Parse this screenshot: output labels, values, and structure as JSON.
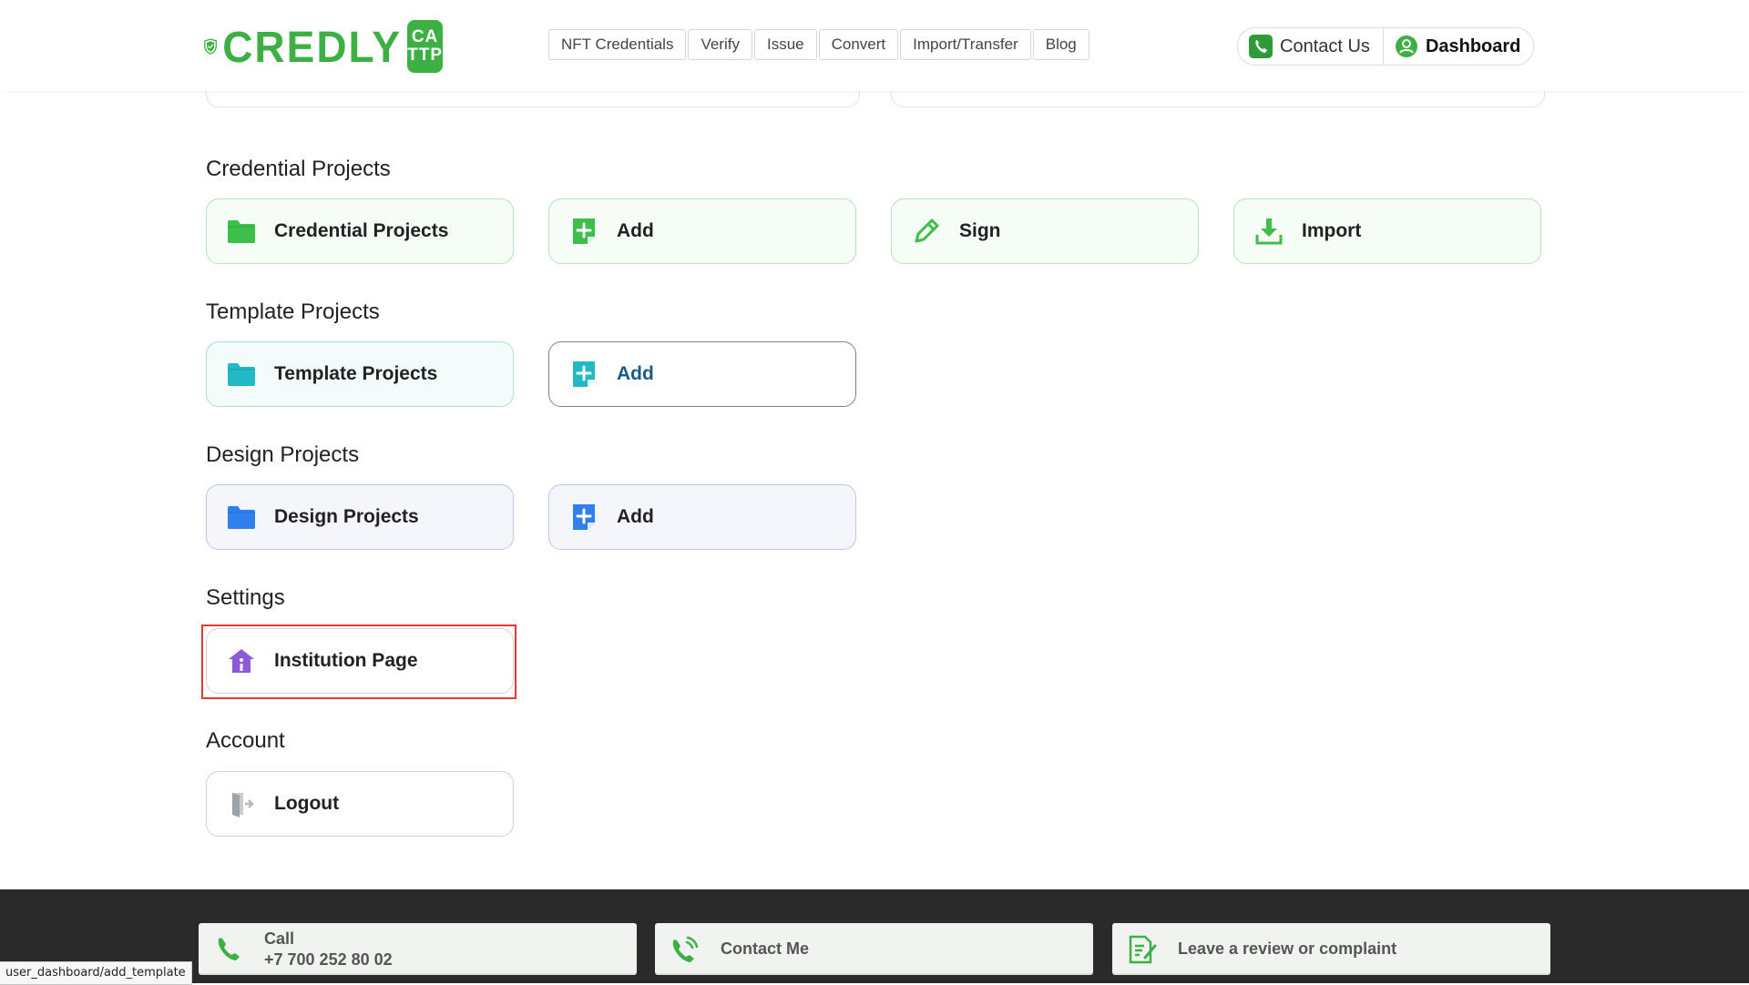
{
  "header": {
    "logo": {
      "word": "CREDLY",
      "badge_line1": "CA",
      "badge_line2": "TTP"
    },
    "nav": [
      "NFT Credentials",
      "Verify",
      "Issue",
      "Convert",
      "Import/Transfer",
      "Blog"
    ],
    "contact_label": "Contact Us",
    "dashboard_label": "Dashboard"
  },
  "sections": {
    "credential": {
      "title": "Credential Projects",
      "cards": [
        {
          "label": "Credential Projects",
          "icon": "folder-icon"
        },
        {
          "label": "Add",
          "icon": "add-file-icon"
        },
        {
          "label": "Sign",
          "icon": "pencil-icon"
        },
        {
          "label": "Import",
          "icon": "download-icon"
        }
      ]
    },
    "template": {
      "title": "Template Projects",
      "cards": [
        {
          "label": "Template Projects",
          "icon": "folder-icon"
        },
        {
          "label": "Add",
          "icon": "add-file-icon"
        }
      ]
    },
    "design": {
      "title": "Design Projects",
      "cards": [
        {
          "label": "Design Projects",
          "icon": "folder-icon"
        },
        {
          "label": "Add",
          "icon": "add-file-icon"
        }
      ]
    },
    "settings": {
      "title": "Settings",
      "cards": [
        {
          "label": "Institution Page",
          "icon": "institution-icon"
        }
      ]
    },
    "account": {
      "title": "Account",
      "cards": [
        {
          "label": "Logout",
          "icon": "logout-icon"
        }
      ]
    }
  },
  "footer": {
    "call_label": "Call",
    "call_number": "+7 700 252 80 02",
    "contact_me": "Contact Me",
    "review": "Leave a review or complaint"
  },
  "status_url": "user_dashboard/add_template",
  "colors": {
    "brand_green": "#3cb043",
    "teal": "#23b9c4",
    "blue": "#2f80ed",
    "purple": "#8e5bd6",
    "highlight_red": "#e53935",
    "footer_bg": "#2a2a2a"
  }
}
